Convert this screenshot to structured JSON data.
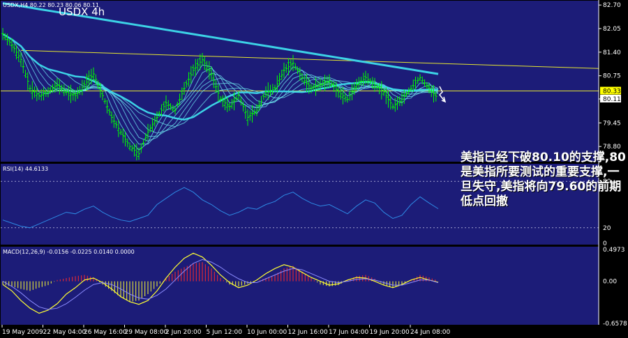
{
  "chart_data": [
    {
      "panel": "price",
      "type": "candlestick",
      "symbol_header": "USDX,H4  80.22 80.23 80.06 80.11",
      "title": "USDX  4h",
      "ylim": [
        78.4,
        82.8
      ],
      "y_ticks": [
        "82.70",
        "82.05",
        "81.40",
        "80.75",
        "80.11",
        "79.45",
        "78.80"
      ],
      "price_markers": [
        {
          "label": "80.33",
          "value": 80.33,
          "color": "#ffff00"
        },
        {
          "label": "80.11",
          "value": 80.11,
          "color": "#ffffff"
        }
      ],
      "horizontal_line": 80.33,
      "trendline": {
        "from": 81.45,
        "to": 80.95
      },
      "close_path": [
        81.9,
        81.6,
        81.2,
        80.4,
        80.2,
        80.3,
        80.5,
        80.3,
        80.2,
        80.5,
        80.8,
        80.2,
        79.6,
        79.2,
        78.8,
        78.6,
        79.2,
        79.6,
        80.0,
        79.8,
        80.4,
        80.9,
        81.2,
        80.8,
        80.1,
        79.9,
        80.2,
        79.6,
        79.8,
        80.3,
        80.4,
        80.9,
        81.1,
        80.7,
        80.4,
        80.5,
        80.6,
        80.3,
        80.1,
        80.5,
        80.7,
        80.5,
        80.3,
        79.9,
        80.1,
        80.4,
        80.7,
        80.4,
        80.11
      ],
      "colors": {
        "up": "#00ff00",
        "down": "#00ff00",
        "background": "#1c1c78",
        "grid": "#6a6aa8",
        "ma_thick": "#3cd2e6",
        "ma_thin": "#6ee6f0"
      }
    },
    {
      "panel": "rsi",
      "type": "line",
      "header": "RSI(14) 44.6133",
      "ylim": [
        0,
        100
      ],
      "y_ticks": [
        "80",
        "20",
        "0"
      ],
      "levels": [
        80,
        20
      ],
      "values": [
        30,
        26,
        22,
        20,
        25,
        30,
        35,
        40,
        38,
        44,
        48,
        40,
        34,
        30,
        28,
        32,
        36,
        50,
        58,
        66,
        72,
        66,
        56,
        50,
        42,
        36,
        40,
        46,
        44,
        50,
        54,
        62,
        66,
        58,
        52,
        48,
        50,
        44,
        38,
        48,
        56,
        52,
        40,
        32,
        36,
        50,
        60,
        52,
        44.6
      ],
      "colors": {
        "line": "#2e8be6"
      }
    },
    {
      "panel": "macd",
      "type": "bar",
      "header": "MACD(12,26,9) -0.0156 -0.0225 0.0140 0.0000",
      "ylim": [
        -0.6578,
        0.4973
      ],
      "y_ticks": [
        "0.4973",
        "0.00",
        "-0.6578"
      ],
      "histogram": [
        -0.05,
        -0.08,
        -0.12,
        -0.15,
        -0.1,
        -0.06,
        0.02,
        0.05,
        0.08,
        0.1,
        0.06,
        -0.05,
        -0.15,
        -0.25,
        -0.32,
        -0.3,
        -0.2,
        -0.08,
        0.05,
        0.15,
        0.22,
        0.28,
        0.3,
        0.2,
        0.05,
        -0.05,
        -0.08,
        -0.04,
        0.0,
        0.05,
        0.1,
        0.2,
        0.24,
        0.15,
        0.05,
        -0.05,
        -0.08,
        -0.06,
        0.02,
        0.08,
        0.1,
        0.04,
        -0.05,
        -0.1,
        -0.06,
        0.02,
        0.1,
        0.06,
        0.01
      ],
      "macd_line": [
        -0.05,
        -0.15,
        -0.3,
        -0.42,
        -0.5,
        -0.45,
        -0.35,
        -0.2,
        -0.1,
        0.02,
        0.05,
        -0.02,
        -0.12,
        -0.24,
        -0.32,
        -0.36,
        -0.3,
        -0.15,
        0.05,
        0.22,
        0.36,
        0.44,
        0.38,
        0.25,
        0.1,
        -0.02,
        -0.1,
        -0.06,
        0.02,
        0.12,
        0.2,
        0.26,
        0.22,
        0.14,
        0.06,
        0.0,
        -0.06,
        -0.04,
        0.02,
        0.06,
        0.05,
        0.0,
        -0.06,
        -0.1,
        -0.05,
        0.02,
        0.06,
        0.02,
        -0.0156
      ],
      "signal_line": [
        0.0,
        -0.08,
        -0.18,
        -0.3,
        -0.4,
        -0.44,
        -0.42,
        -0.35,
        -0.25,
        -0.14,
        -0.05,
        -0.02,
        -0.05,
        -0.12,
        -0.2,
        -0.26,
        -0.28,
        -0.22,
        -0.12,
        0.02,
        0.16,
        0.28,
        0.34,
        0.3,
        0.22,
        0.12,
        0.04,
        -0.02,
        -0.02,
        0.04,
        0.1,
        0.16,
        0.2,
        0.18,
        0.12,
        0.06,
        0.0,
        -0.02,
        0.0,
        0.03,
        0.04,
        0.02,
        -0.02,
        -0.06,
        -0.06,
        -0.02,
        0.02,
        0.02,
        -0.0225
      ],
      "colors": {
        "pos": "#ff2a2a",
        "neg": "#ffff33",
        "macd": "#ffff33",
        "signal": "#8c8cff"
      }
    }
  ],
  "x_labels": [
    "19 May 2009",
    "22 May 04:00",
    "26 May 16:00",
    "29 May 08:00",
    "2 Jun 20:00",
    "5 Jun 12:00",
    "10 Jun 00:00",
    "12 Jun 16:00",
    "17 Jun 04:00",
    "19 Jun 20:00",
    "24 Jun 08:00"
  ],
  "annotation": "美指已经下破80.10的支撑,80是美指所要测试的重要支撑,一旦失守,美指将向79.60的前期低点回撤"
}
